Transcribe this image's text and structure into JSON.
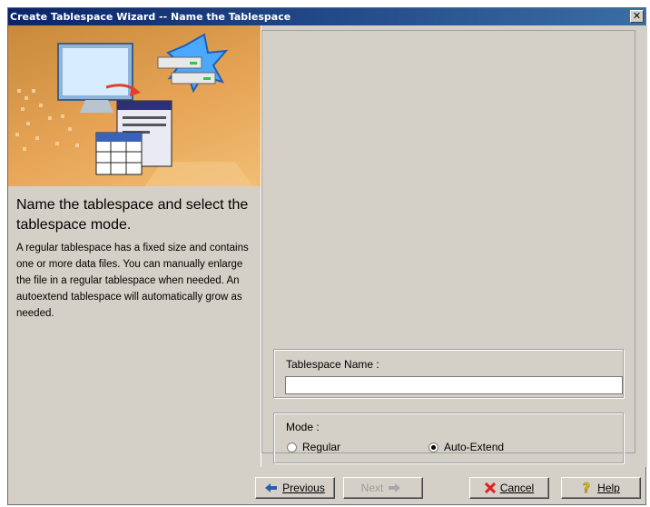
{
  "window": {
    "title": "Create Tablespace Wizard -- Name the Tablespace",
    "close_symbol": "✕"
  },
  "left": {
    "heading": "Name the tablespace and select the tablespace mode.",
    "description": "A regular tablespace has a fixed size and contains one or more data files. You can manually enlarge the file in a regular tablespace when needed. An autoextend tablespace will automatically grow as needed."
  },
  "form": {
    "name_label": "Tablespace Name :",
    "name_value": "",
    "mode_label": "Mode :",
    "mode_options": [
      {
        "label": "Regular",
        "selected": false
      },
      {
        "label": "Auto-Extend",
        "selected": true
      }
    ]
  },
  "buttons": {
    "previous": "Previous",
    "next": "Next",
    "cancel": "Cancel",
    "help": "Help"
  },
  "colors": {
    "title_start": "#0a246a",
    "title_end": "#3a6ea5",
    "panel": "#d4d0c8",
    "banner": "#e7a456"
  }
}
